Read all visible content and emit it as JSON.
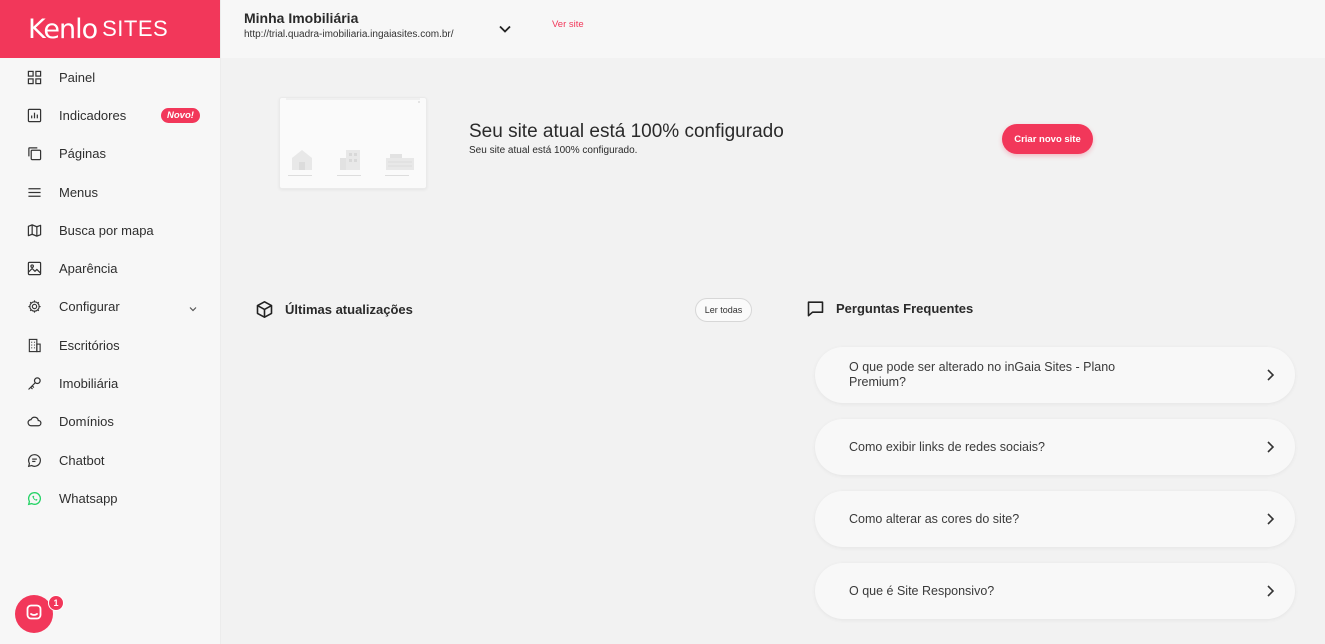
{
  "brand": {
    "name": "Kenlo",
    "product": "SITES",
    "accent": "#f2375a"
  },
  "sidebar": {
    "items": [
      {
        "label": "Painel",
        "icon": "grid-icon"
      },
      {
        "label": "Indicadores",
        "icon": "bar-chart-icon",
        "badge": "Novo!"
      },
      {
        "label": "Páginas",
        "icon": "copy-pages-icon"
      },
      {
        "label": "Menus",
        "icon": "hamburger-icon"
      },
      {
        "label": "Busca por mapa",
        "icon": "map-icon"
      },
      {
        "label": "Aparência",
        "icon": "image-icon"
      },
      {
        "label": "Configurar",
        "icon": "gear-icon",
        "expandable": true
      },
      {
        "label": "Escritórios",
        "icon": "building-icon"
      },
      {
        "label": "Imobiliária",
        "icon": "key-icon"
      },
      {
        "label": "Domínios",
        "icon": "cloud-icon"
      },
      {
        "label": "Chatbot",
        "icon": "chat-bubble-icon"
      },
      {
        "label": "Whatsapp",
        "icon": "whatsapp-icon",
        "icon_color": "#25d366"
      }
    ],
    "chat_widget": {
      "count": "1",
      "icon": "chat-launcher-icon"
    }
  },
  "header": {
    "site_name": "Minha Imobiliária",
    "site_url": "http://trial.quadra-imobiliaria.ingaiasites.com.br/",
    "view_site_label": "Ver site"
  },
  "hero": {
    "title": "Seu site atual está 100% configurado",
    "subtitle": "Seu site atual está 100% configurado.",
    "create_button": "Criar novo site"
  },
  "updates": {
    "title": "Últimas atualizações",
    "read_all_button": "Ler todas",
    "icon": "box-icon"
  },
  "faq": {
    "title": "Perguntas Frequentes",
    "icon": "message-square-icon",
    "items": [
      {
        "question": "O que pode ser alterado no inGaia Sites - Plano Premium?"
      },
      {
        "question": "Como exibir links de redes sociais?"
      },
      {
        "question": "Como alterar as cores do site?"
      },
      {
        "question": "O que é Site Responsivo?"
      }
    ]
  }
}
